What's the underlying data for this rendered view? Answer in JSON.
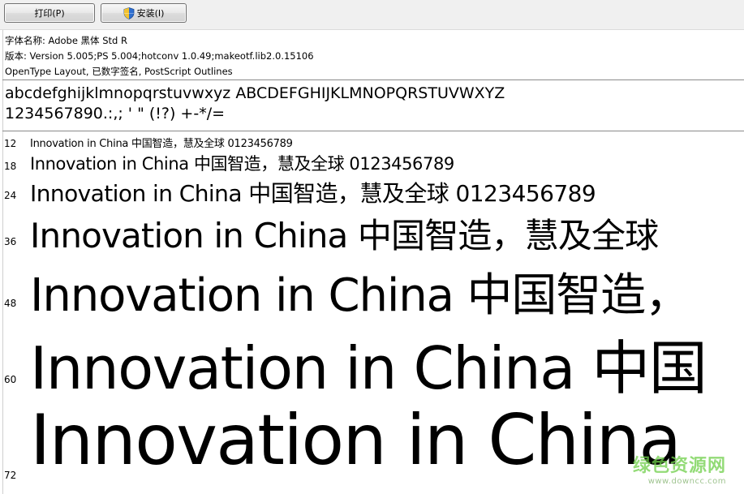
{
  "toolbar": {
    "print_label": "打印(P)",
    "install_label": "安装(I)"
  },
  "info": {
    "font_name": "字体名称: Adobe 黑体 Std R",
    "version": "版本: Version 5.005;PS 5.004;hotconv 1.0.49;makeotf.lib2.0.15106",
    "features": "OpenType Layout, 已数字签名, PostScript Outlines"
  },
  "charset": {
    "letters": "abcdefghijklmnopqrstuvwxyz ABCDEFGHIJKLMNOPQRSTUVWXYZ",
    "digits": "1234567890.:,; ' \" (!?) +-*/="
  },
  "samples": [
    {
      "size": "12",
      "text": "Innovation in China 中国智造，慧及全球 0123456789"
    },
    {
      "size": "18",
      "text": "Innovation in China 中国智造，慧及全球 0123456789"
    },
    {
      "size": "24",
      "text": "Innovation in China 中国智造，慧及全球 0123456789"
    },
    {
      "size": "36",
      "text": "Innovation in China 中国智造，慧及全球"
    },
    {
      "size": "48",
      "text": "Innovation in China 中国智造，"
    },
    {
      "size": "60",
      "text": "Innovation in China 中国"
    },
    {
      "size": "72",
      "text": "Innovation in China"
    }
  ],
  "watermark": {
    "main": "绿色资源网",
    "sub": "www.downcc.com"
  },
  "colors": {
    "toolbar_bg": "#f0f0f0",
    "watermark": "#6fcf4a"
  },
  "icons": {
    "install": "shield-icon"
  }
}
